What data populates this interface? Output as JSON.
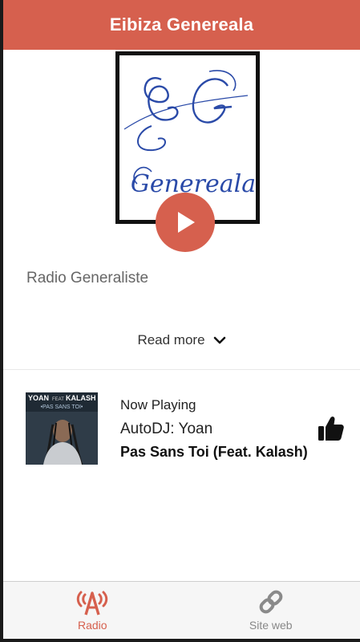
{
  "header": {
    "title": "Eibiza Genereala"
  },
  "station": {
    "logo_text": "Genereala",
    "description": "Radio Generaliste",
    "read_more_label": "Read more"
  },
  "now_playing": {
    "label": "Now Playing",
    "artist": "AutoDJ: Yoan",
    "title": "Pas Sans Toi (Feat. Kalash)",
    "album_art": {
      "artist_text": "YOAN",
      "feat_text": "FEAT",
      "feat_artist_text": "KALASH",
      "title_text": "•PAS SANS TOI•"
    }
  },
  "tabs": [
    {
      "label": "Radio",
      "icon": "radio-tower-icon",
      "active": true
    },
    {
      "label": "Site web",
      "icon": "link-icon",
      "active": false
    }
  ],
  "colors": {
    "accent": "#d6604e",
    "logo_script": "#2a4aa8"
  }
}
